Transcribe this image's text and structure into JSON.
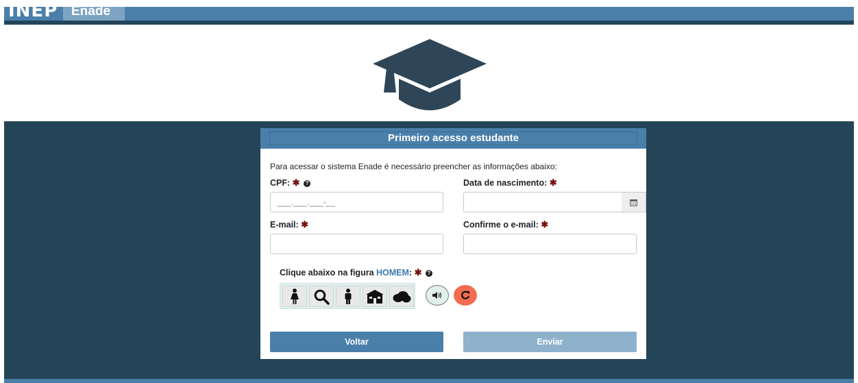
{
  "header": {
    "logo_text": "INEP",
    "app_name": "Enade"
  },
  "form": {
    "title": "Primeiro acesso estudante",
    "intro": "Para acessar o sistema Enade é necessário preencher as informações abaixo:",
    "cpf_label": "CPF:",
    "cpf_placeholder": "___.___.___-__",
    "birth_label": "Data de nascimento:",
    "email_label": "E-mail:",
    "confirm_email_label": "Confirme o e-mail:",
    "required_mark": "✱",
    "help_mark": "?"
  },
  "captcha": {
    "label_prefix": "Clique abaixo na figura",
    "target": "HOMEM",
    "label_suffix": ":",
    "icons": [
      "woman-icon",
      "magnifier-icon",
      "man-icon",
      "house-icon",
      "cloud-icon"
    ]
  },
  "buttons": {
    "back": "Voltar",
    "send": "Enviar"
  },
  "colors": {
    "brand_blue": "#4a7faa",
    "dark_band": "#244457",
    "disabled_blue": "#8fb2cc",
    "refresh_orange": "#f26c4f",
    "required_red": "#7a1010"
  }
}
